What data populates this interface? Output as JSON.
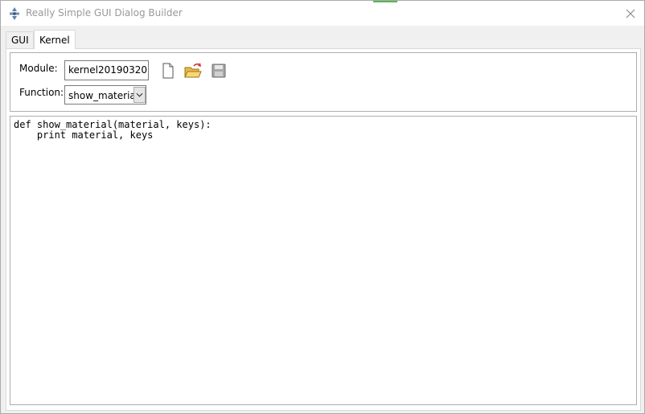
{
  "window": {
    "title": "Really Simple GUI Dialog Builder",
    "accent_color": "#5ab55a"
  },
  "tabs": [
    {
      "label": "GUI",
      "active": false
    },
    {
      "label": "Kernel",
      "active": true
    }
  ],
  "kernel": {
    "module_label": "Module:",
    "module_value": "kernel20190320",
    "function_label": "Function:",
    "function_value": "show_material",
    "toolbar_icons": [
      "new-file-icon",
      "open-folder-icon",
      "save-disk-icon"
    ]
  },
  "code": {
    "lines": [
      "def show_material(material, keys):",
      "    print material, keys"
    ]
  }
}
